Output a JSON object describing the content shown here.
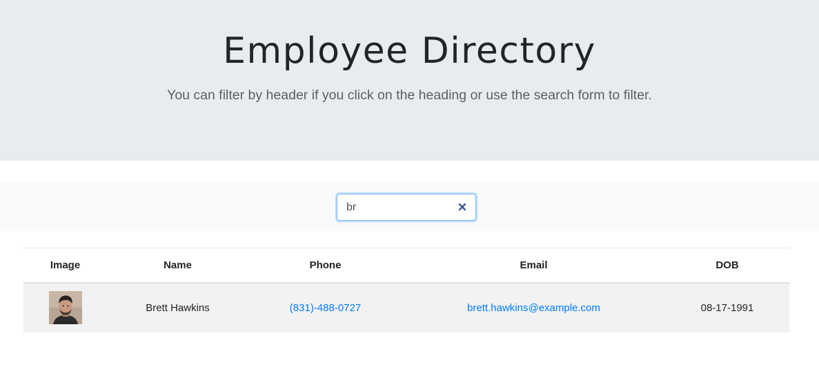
{
  "header": {
    "title": "Employee Directory",
    "subtitle": "You can filter by header if you click on the heading or use the search form to filter."
  },
  "search": {
    "value": "br",
    "placeholder": ""
  },
  "table": {
    "columns": [
      "Image",
      "Name",
      "Phone",
      "Email",
      "DOB"
    ],
    "rows": [
      {
        "image": "avatar",
        "name": "Brett Hawkins",
        "phone": "(831)-488-0727",
        "email": "brett.hawkins@example.com",
        "dob": "08-17-1991"
      }
    ]
  },
  "colors": {
    "jumbotron_bg": "#e9ecef",
    "search_bar_bg": "#f8f9fa",
    "link": "#007bff",
    "row_bg": "#f2f2f2"
  },
  "icons": {
    "clear": "close-icon"
  }
}
